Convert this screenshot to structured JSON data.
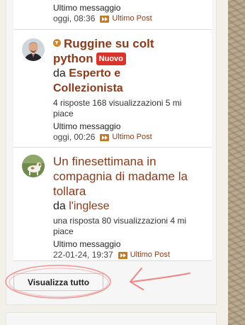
{
  "top_item": {
    "last_message_label": "Ultimo messaggio",
    "time": "oggi, 08:36",
    "last_post_label": "Ultimo Post"
  },
  "topics": [
    {
      "title_line1": "Ruggine su colt",
      "title_line2": "python",
      "badge": "Nuovo",
      "by_prefix": "da",
      "author_line1": "Esperto e",
      "author_line2": "Collezionista",
      "stats_line1": "4 risposte 168 visualizzazioni 5 mi",
      "stats_line2": "piace",
      "last_message_label": "Ultimo messaggio",
      "time": "oggi, 00:26",
      "last_post_label": "Ultimo Post"
    },
    {
      "title_line1": "Un finesettimana in",
      "title_line2": "compagnia di madame la",
      "title_line3": "tollara",
      "by_prefix": "da",
      "author": "l'inglese",
      "stats_line1": "una risposta 80 visualizzazioni 4 mi",
      "stats_line2": "piace",
      "last_message_label": "Ultimo messaggio",
      "time": "22-01-24, 19:37",
      "last_post_label": "Ultimo Post"
    }
  ],
  "view_all_label": "Visualizza tutto",
  "colors": {
    "link": "#8b3a1a",
    "badge": "#d9342b",
    "post_icon": "#c67a1e",
    "annotation": "#f08080"
  }
}
